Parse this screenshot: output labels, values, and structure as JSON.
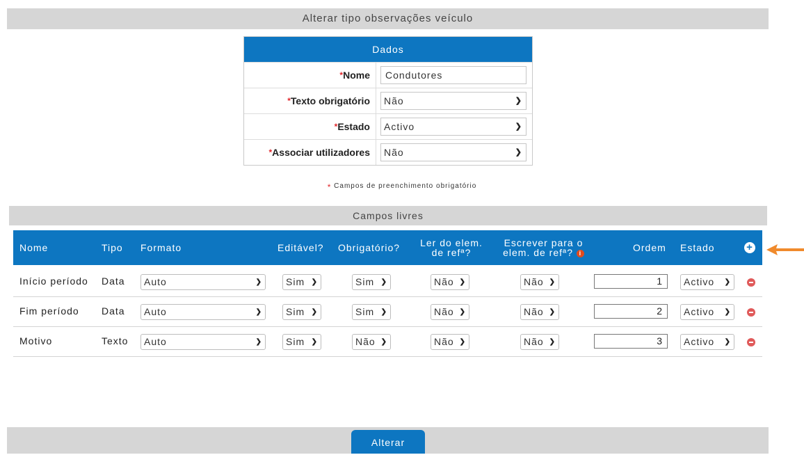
{
  "page": {
    "title": "Alterar tipo observações veículo"
  },
  "dados": {
    "header": "Dados",
    "fields": [
      {
        "label": "Nome",
        "type": "text",
        "value": "Condutores"
      },
      {
        "label": "Texto obrigatório",
        "type": "select",
        "value": "Não"
      },
      {
        "label": "Estado",
        "type": "select",
        "value": "Activo"
      },
      {
        "label": "Associar utilizadores",
        "type": "select",
        "value": "Não"
      }
    ],
    "required_mark": "*",
    "required_note": "Campos de preenchimento obrigatório"
  },
  "campos": {
    "header": "Campos livres",
    "columns": {
      "nome": "Nome",
      "tipo": "Tipo",
      "formato": "Formato",
      "editavel": "Editável?",
      "obrigatorio": "Obrigatório?",
      "ler_line1": "Ler do elem.",
      "ler_line2": "de refª?",
      "escrever_line1": "Escrever para o",
      "escrever_line2": "elem. de refª?",
      "ordem": "Ordem",
      "estado": "Estado"
    },
    "info_icon": "info-icon",
    "add_icon": "plus-circle-icon",
    "rows": [
      {
        "nome": "Início período",
        "tipo": "Data",
        "formato": "Auto",
        "editavel": "Sim",
        "obrigatorio": "Sim",
        "ler": "Não",
        "escrever": "Não",
        "ordem": "1",
        "estado": "Activo"
      },
      {
        "nome": "Fim período",
        "tipo": "Data",
        "formato": "Auto",
        "editavel": "Sim",
        "obrigatorio": "Sim",
        "ler": "Não",
        "escrever": "Não",
        "ordem": "2",
        "estado": "Activo"
      },
      {
        "nome": "Motivo",
        "tipo": "Texto",
        "formato": "Auto",
        "editavel": "Sim",
        "obrigatorio": "Não",
        "ler": "Não",
        "escrever": "Não",
        "ordem": "3",
        "estado": "Activo"
      }
    ]
  },
  "footer": {
    "submit_label": "Alterar"
  },
  "colors": {
    "primary": "#0d76c1",
    "bar": "#d6d6d6",
    "required": "#e0262b",
    "annotation_arrow": "#f08a2c"
  }
}
